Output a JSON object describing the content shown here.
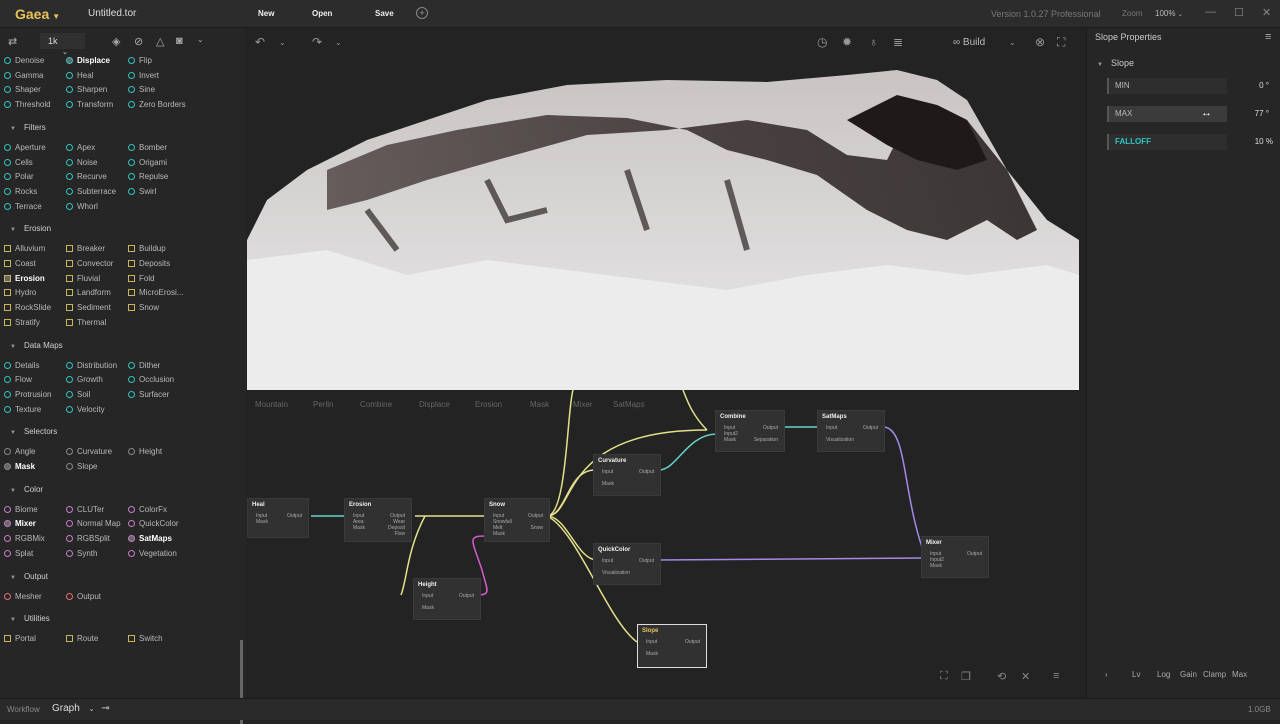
{
  "topbar": {
    "app_name": "Gaea",
    "file_name": "Untitled.tor",
    "new_label": "New",
    "open_label": "Open",
    "save_label": "Save",
    "version": "Version 1.0.27 Professional",
    "zoom_label": "Zoom",
    "zoom_value": "100%"
  },
  "left_panel": {
    "resolution": "1k",
    "top_items": [
      [
        "Denoise",
        "Displace",
        "Flip"
      ],
      [
        "Gamma",
        "Heal",
        "Invert"
      ],
      [
        "Shaper",
        "Sharpen",
        "Sine"
      ],
      [
        "Threshold",
        "Transform",
        "Zero Borders"
      ]
    ],
    "sections": [
      {
        "title": "Filters",
        "items": [
          [
            "Aperture",
            "Apex",
            "Bomber"
          ],
          [
            "Cells",
            "Noise",
            "Origami"
          ],
          [
            "Polar",
            "Recurve",
            "Repulse"
          ],
          [
            "Rocks",
            "Subterrace",
            "Swirl"
          ],
          [
            "Terrace",
            "Whorl",
            ""
          ]
        ]
      },
      {
        "title": "Erosion",
        "items": [
          [
            "Alluvium",
            "Breaker",
            "Buildup"
          ],
          [
            "Coast",
            "Convector",
            "Deposits"
          ],
          [
            "Erosion",
            "Fluvial",
            "Fold"
          ],
          [
            "Hydro",
            "Landform",
            "MicroErosi..."
          ],
          [
            "RockSlide",
            "Sediment",
            "Snow"
          ],
          [
            "Stratify",
            "Thermal",
            ""
          ]
        ]
      },
      {
        "title": "Data Maps",
        "items": [
          [
            "Details",
            "Distribution",
            "Dither"
          ],
          [
            "Flow",
            "Growth",
            "Occlusion"
          ],
          [
            "Protrusion",
            "Soil",
            "Surfacer"
          ],
          [
            "Texture",
            "Velocity",
            ""
          ]
        ]
      },
      {
        "title": "Selectors",
        "items": [
          [
            "Angle",
            "Curvature",
            "Height"
          ],
          [
            "Mask",
            "Slope",
            ""
          ]
        ]
      },
      {
        "title": "Color",
        "items": [
          [
            "Biome",
            "CLUTer",
            "ColorFx"
          ],
          [
            "Mixer",
            "Normal Map",
            "QuickColor"
          ],
          [
            "RGBMix",
            "RGBSplit",
            "SatMaps"
          ],
          [
            "Splat",
            "Synth",
            "Vegetation"
          ]
        ]
      },
      {
        "title": "Output",
        "items": [
          [
            "Mesher",
            "Output",
            ""
          ]
        ]
      },
      {
        "title": "Utilities",
        "items": [
          [
            "Portal",
            "Route",
            "Switch"
          ]
        ]
      }
    ]
  },
  "viewport": {
    "build_label": "Build",
    "favorites": [
      "Mountain",
      "Perlin",
      "Combine",
      "Displace",
      "Erosion",
      "Mask",
      "Mixer",
      "SatMaps"
    ]
  },
  "nodes": [
    {
      "title": "Heal",
      "ports": [
        "Input",
        "Mask"
      ],
      "outputs": [
        "Output"
      ]
    },
    {
      "title": "Erosion",
      "ports": [
        "Input",
        "Area",
        "Mask"
      ],
      "outputs": [
        "Output",
        "Wear",
        "Deposit",
        "Flow"
      ]
    },
    {
      "title": "Snow",
      "ports": [
        "Input",
        "Snowfall",
        "Melt",
        "Mask"
      ],
      "outputs": [
        "Output",
        "Snow"
      ]
    },
    {
      "title": "Height",
      "ports": [
        "Input",
        "Mask"
      ],
      "outputs": [
        "Output"
      ]
    },
    {
      "title": "Curvature",
      "ports": [
        "Input",
        "Mask"
      ],
      "outputs": [
        "Output"
      ]
    },
    {
      "title": "Combine",
      "ports": [
        "Input",
        "Input2",
        "Mask"
      ],
      "outputs": [
        "Output",
        "Separation"
      ]
    },
    {
      "title": "SatMaps",
      "ports": [
        "Input",
        "Visualization"
      ],
      "outputs": [
        "Output"
      ]
    },
    {
      "title": "QuickColor",
      "ports": [
        "Input",
        "Visualization"
      ],
      "outputs": [
        "Output"
      ]
    },
    {
      "title": "Slope",
      "ports": [
        "Input",
        "Mask"
      ],
      "outputs": [
        "Output"
      ]
    },
    {
      "title": "Mixer",
      "ports": [
        "Input",
        "Input2",
        "Mask"
      ],
      "outputs": [
        "Output"
      ]
    }
  ],
  "properties": {
    "panel_title": "Slope Properties",
    "section": "Slope",
    "min_label": "MIN",
    "min_value": "0",
    "max_label": "MAX",
    "max_value": "77",
    "falloff_label": "FALLOFF",
    "falloff_value": "10",
    "deg_unit": "°",
    "pct_unit": "%",
    "bottom_tabs": [
      "Lv",
      "Log",
      "Gain",
      "Clamp",
      "Max"
    ]
  },
  "bottombar": {
    "workflow_label": "Workflow",
    "mode": "Graph",
    "memory": "1.0GB"
  }
}
